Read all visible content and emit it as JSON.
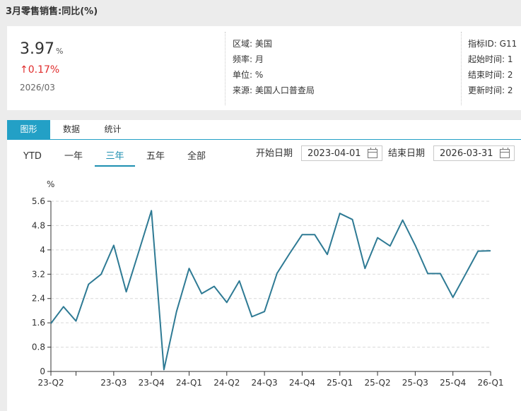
{
  "page_title": "3月零售销售:同比(%)",
  "summary": {
    "value": "3.97",
    "unit": "%",
    "change": "↑0.17%",
    "period": "2026/03",
    "change_color": "#e02b2b"
  },
  "meta_left": [
    {
      "label": "区域",
      "value": "美国"
    },
    {
      "label": "频率",
      "value": "月"
    },
    {
      "label": "单位",
      "value": "%"
    },
    {
      "label": "来源",
      "value": "美国人口普查局"
    }
  ],
  "meta_right": [
    {
      "label": "指标ID",
      "value": "G11"
    },
    {
      "label": "起始时间",
      "value": "1"
    },
    {
      "label": "结束时间",
      "value": "2"
    },
    {
      "label": "更新时间",
      "value": "2"
    }
  ],
  "tabs": [
    {
      "label": "图形",
      "active": true
    },
    {
      "label": "数据",
      "active": false
    },
    {
      "label": "统计",
      "active": false
    }
  ],
  "ranges": [
    {
      "label": "YTD",
      "active": false
    },
    {
      "label": "一年",
      "active": false
    },
    {
      "label": "三年",
      "active": true
    },
    {
      "label": "五年",
      "active": false
    },
    {
      "label": "全部",
      "active": false
    }
  ],
  "date_range": {
    "start_label": "开始日期",
    "start": "2023-04-01",
    "end_label": "结束日期",
    "end": "2026-03-31"
  },
  "accent_color": "#23a0c6",
  "chart_data": {
    "type": "line",
    "ylabel": "%",
    "ylim": [
      0,
      5.6
    ],
    "yticks": [
      0,
      0.8,
      1.6,
      2.4,
      3.2,
      4,
      4.8,
      5.6
    ],
    "ytick_labels": [
      "0",
      "0.8",
      "1.6",
      "2.4",
      "3.2",
      "4",
      "4.8",
      "5.6"
    ],
    "x_tick_labels": [
      "23-Q2",
      "",
      "23-Q3",
      "23-Q4",
      "24-Q1",
      "24-Q2",
      "24-Q3",
      "24-Q4",
      "25-Q1",
      "25-Q2",
      "25-Q3",
      "25-Q4",
      "26-Q1"
    ],
    "x_tick_months": [
      0,
      2,
      5,
      8,
      11,
      14,
      17,
      20,
      23,
      26,
      29,
      32,
      35
    ],
    "grid": true,
    "color": "#2e7a94",
    "series": [
      {
        "values": [
          1.58,
          2.13,
          1.66,
          2.87,
          3.2,
          4.15,
          2.62,
          3.95,
          5.29,
          0.06,
          1.97,
          3.39,
          2.56,
          2.8,
          2.27,
          2.98,
          1.8,
          1.97,
          3.23,
          3.88,
          4.5,
          4.5,
          3.85,
          5.2,
          5.0,
          3.39,
          4.4,
          4.13,
          4.98,
          4.15,
          3.22,
          3.22,
          2.44,
          3.2,
          3.96,
          3.97
        ]
      }
    ]
  }
}
